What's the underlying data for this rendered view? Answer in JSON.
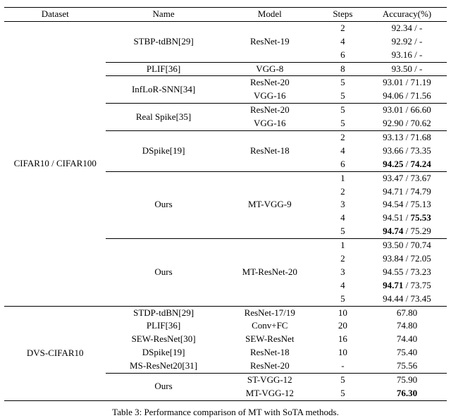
{
  "header": {
    "dataset": "Dataset",
    "name": "Name",
    "model": "Model",
    "steps": "Steps",
    "acc": "Accuracy(%)"
  },
  "cifar": {
    "dataset": "CIFAR10 / CIFAR100",
    "stbp": {
      "name": "STBP-tdBN[29]",
      "model": "ResNet-19",
      "s1": "2",
      "a1": "92.34 / -",
      "s2": "4",
      "a2": "92.92 / -",
      "s3": "6",
      "a3": "93.16 / -"
    },
    "plif": {
      "name": "PLIF[36]",
      "model": "VGG-8",
      "s": "8",
      "a": "93.50 / -"
    },
    "inflor": {
      "name": "InfLoR-SNN[34]",
      "m1": "ResNet-20",
      "s1": "5",
      "a1": "93.01 / 71.19",
      "m2": "VGG-16",
      "s2": "5",
      "a2": "94.06 / 71.56"
    },
    "real": {
      "name": "Real Spike[35]",
      "m1": "ResNet-20",
      "s1": "5",
      "a1": "93.01 / 66.60",
      "m2": "VGG-16",
      "s2": "5",
      "a2": "92.90 / 70.62"
    },
    "dspike": {
      "name": "DSpike[19]",
      "model": "ResNet-18",
      "s1": "2",
      "a1": "93.13 / 71.68",
      "s2": "4",
      "a2": "93.66 / 73.35",
      "s3": "6",
      "a3_p1": "94.25",
      "a3_sep": " / ",
      "a3_p2": "74.24"
    },
    "ours_vgg": {
      "name": "Ours",
      "model": "MT-VGG-9",
      "s1": "1",
      "a1": "93.47 / 73.67",
      "s2": "2",
      "a2": "94.71 / 74.79",
      "s3": "3",
      "a3": "94.54 / 75.13",
      "s4": "4",
      "a4_p1": "94.51 / ",
      "a4_p2": "75.53",
      "s5": "5",
      "a5_p1": "94.74",
      "a5_p2": " / 75.29"
    },
    "ours_res": {
      "name": "Ours",
      "model": "MT-ResNet-20",
      "s1": "1",
      "a1": "93.50 / 70.74",
      "s2": "2",
      "a2": "93.84 / 72.05",
      "s3": "3",
      "a3": "94.55 / 73.23",
      "s4": "4",
      "a4_p1": "94.71",
      "a4_p2": " / 73.75",
      "s5": "5",
      "a5": "94.44 / 73.45"
    }
  },
  "dvs": {
    "dataset": "DVS-CIFAR10",
    "stdp": {
      "name": "STDP-tdBN[29]",
      "model": "ResNet-17/19",
      "s": "10",
      "a": "67.80"
    },
    "plif": {
      "name": "PLIF[36]",
      "model": "Conv+FC",
      "s": "20",
      "a": "74.80"
    },
    "sew": {
      "name": "SEW-ResNet[30]",
      "model": "SEW-ResNet",
      "s": "16",
      "a": "74.40"
    },
    "dspk": {
      "name": "DSpike[19]",
      "model": "ResNet-18",
      "s": "10",
      "a": "75.40"
    },
    "ms": {
      "name": "MS-ResNet20[31]",
      "model": "ResNet-20",
      "s": "-",
      "a": "75.56"
    },
    "ours": {
      "name": "Ours",
      "m1": "ST-VGG-12",
      "s1": "5",
      "a1": "75.90",
      "m2": "MT-VGG-12",
      "s2": "5",
      "a2": "76.30"
    }
  },
  "caption": "Table 3: Performance comparison of MT with SoTA methods.",
  "chart_data": {
    "type": "table",
    "title": "Table 3: Performance comparison of MT with SoTA methods.",
    "columns": [
      "Dataset",
      "Name",
      "Model",
      "Steps",
      "Accuracy(%)"
    ],
    "rows": [
      [
        "CIFAR10 / CIFAR100",
        "STBP-tdBN[29]",
        "ResNet-19",
        2,
        "92.34 / -"
      ],
      [
        "CIFAR10 / CIFAR100",
        "STBP-tdBN[29]",
        "ResNet-19",
        4,
        "92.92 / -"
      ],
      [
        "CIFAR10 / CIFAR100",
        "STBP-tdBN[29]",
        "ResNet-19",
        6,
        "93.16 / -"
      ],
      [
        "CIFAR10 / CIFAR100",
        "PLIF[36]",
        "VGG-8",
        8,
        "93.50 / -"
      ],
      [
        "CIFAR10 / CIFAR100",
        "InfLoR-SNN[34]",
        "ResNet-20",
        5,
        "93.01 / 71.19"
      ],
      [
        "CIFAR10 / CIFAR100",
        "InfLoR-SNN[34]",
        "VGG-16",
        5,
        "94.06 / 71.56"
      ],
      [
        "CIFAR10 / CIFAR100",
        "Real Spike[35]",
        "ResNet-20",
        5,
        "93.01 / 66.60"
      ],
      [
        "CIFAR10 / CIFAR100",
        "Real Spike[35]",
        "VGG-16",
        5,
        "92.90 / 70.62"
      ],
      [
        "CIFAR10 / CIFAR100",
        "DSpike[19]",
        "ResNet-18",
        2,
        "93.13 / 71.68"
      ],
      [
        "CIFAR10 / CIFAR100",
        "DSpike[19]",
        "ResNet-18",
        4,
        "93.66 / 73.35"
      ],
      [
        "CIFAR10 / CIFAR100",
        "DSpike[19]",
        "ResNet-18",
        6,
        "94.25 / 74.24"
      ],
      [
        "CIFAR10 / CIFAR100",
        "Ours",
        "MT-VGG-9",
        1,
        "93.47 / 73.67"
      ],
      [
        "CIFAR10 / CIFAR100",
        "Ours",
        "MT-VGG-9",
        2,
        "94.71 / 74.79"
      ],
      [
        "CIFAR10 / CIFAR100",
        "Ours",
        "MT-VGG-9",
        3,
        "94.54 / 75.13"
      ],
      [
        "CIFAR10 / CIFAR100",
        "Ours",
        "MT-VGG-9",
        4,
        "94.51 / 75.53"
      ],
      [
        "CIFAR10 / CIFAR100",
        "Ours",
        "MT-VGG-9",
        5,
        "94.74 / 75.29"
      ],
      [
        "CIFAR10 / CIFAR100",
        "Ours",
        "MT-ResNet-20",
        1,
        "93.50 / 70.74"
      ],
      [
        "CIFAR10 / CIFAR100",
        "Ours",
        "MT-ResNet-20",
        2,
        "93.84 / 72.05"
      ],
      [
        "CIFAR10 / CIFAR100",
        "Ours",
        "MT-ResNet-20",
        3,
        "94.55 / 73.23"
      ],
      [
        "CIFAR10 / CIFAR100",
        "Ours",
        "MT-ResNet-20",
        4,
        "94.71 / 73.75"
      ],
      [
        "CIFAR10 / CIFAR100",
        "Ours",
        "MT-ResNet-20",
        5,
        "94.44 / 73.45"
      ],
      [
        "DVS-CIFAR10",
        "STDP-tdBN[29]",
        "ResNet-17/19",
        10,
        "67.80"
      ],
      [
        "DVS-CIFAR10",
        "PLIF[36]",
        "Conv+FC",
        20,
        "74.80"
      ],
      [
        "DVS-CIFAR10",
        "SEW-ResNet[30]",
        "SEW-ResNet",
        16,
        "74.40"
      ],
      [
        "DVS-CIFAR10",
        "DSpike[19]",
        "ResNet-18",
        10,
        "75.40"
      ],
      [
        "DVS-CIFAR10",
        "MS-ResNet20[31]",
        "ResNet-20",
        "-",
        "75.56"
      ],
      [
        "DVS-CIFAR10",
        "Ours",
        "ST-VGG-12",
        5,
        "75.90"
      ],
      [
        "DVS-CIFAR10",
        "Ours",
        "MT-VGG-12",
        5,
        "76.30"
      ]
    ]
  }
}
